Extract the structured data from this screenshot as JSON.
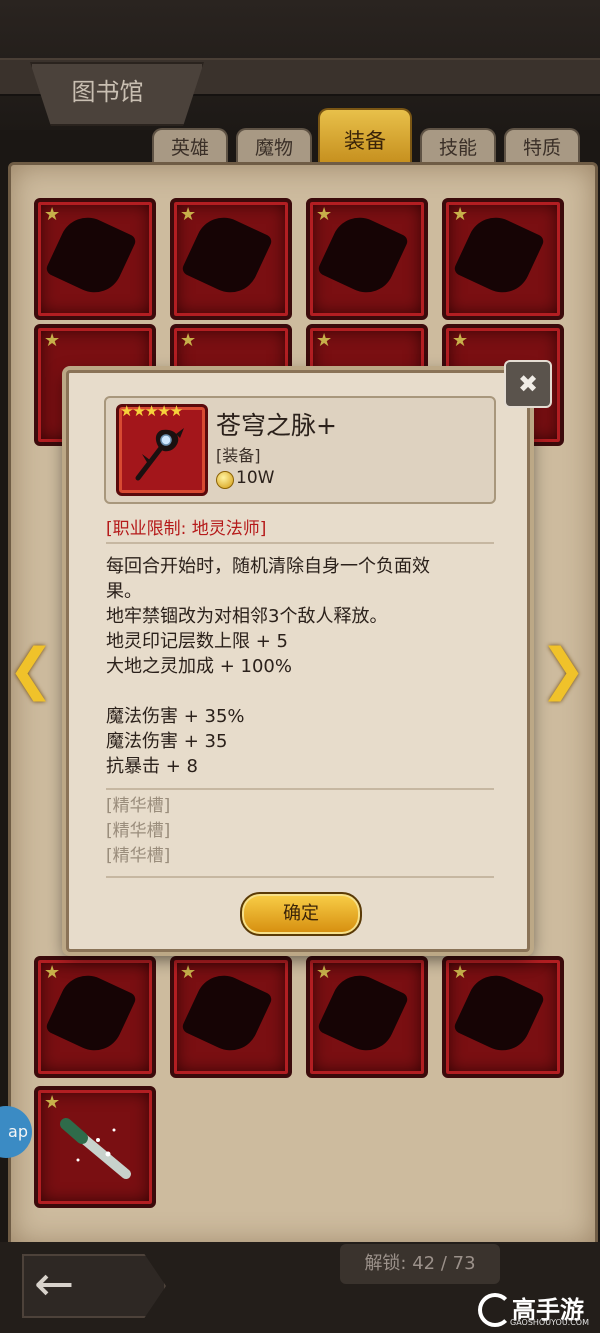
{
  "header": {
    "title": "图书馆"
  },
  "tabs": [
    {
      "label": "英雄",
      "active": false
    },
    {
      "label": "魔物",
      "active": false
    },
    {
      "label": "装备",
      "active": true
    },
    {
      "label": "技能",
      "active": false
    },
    {
      "label": "特质",
      "active": false
    }
  ],
  "popup": {
    "item_name": "苍穹之脉+",
    "item_type": "[装备]",
    "stars": "★★★★★",
    "price": "10W",
    "class_restriction": "[职业限制: 地灵法师]",
    "effects": [
      "每回合开始时，随机清除自身一个负面效",
      "果。",
      "地牢禁锢改为对相邻3个敌人释放。",
      "地灵印记层数上限 + 5",
      "大地之灵加成 + 100%"
    ],
    "stats": [
      "魔法伤害 + 35%",
      "魔法伤害 + 35",
      "抗暴击 + 8"
    ],
    "essence_slots": [
      "[精华槽]",
      "[精华槽]",
      "[精华槽]"
    ],
    "confirm_label": "确定"
  },
  "footer": {
    "unlock_text": "解锁: 42 / 73",
    "back_icon": "←",
    "watermark_brand": "高手游",
    "watermark_url": "GAOSHOUYOU.COM"
  },
  "side_bubble": "ap",
  "colors": {
    "accent_gold": "#f0c22a",
    "slot_red": "#7a0f12",
    "restriction_red": "#b51a1a"
  }
}
